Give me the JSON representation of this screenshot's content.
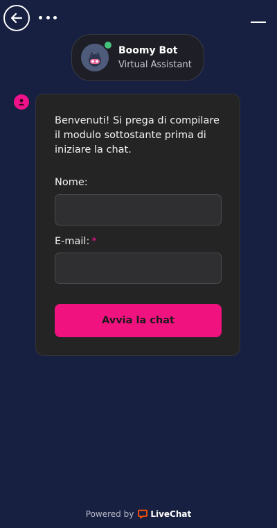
{
  "bot": {
    "name": "Boomy Bot",
    "role": "Virtual Assistant"
  },
  "form": {
    "intro": "Benvenuti! Si prega di compilare il modulo sottostante prima di iniziare la chat.",
    "name_label": "Nome:",
    "email_label": "E-mail:",
    "required_mark": "*",
    "submit_label": "Avvia la chat"
  },
  "footer": {
    "powered_by": "Powered by",
    "brand": "LiveChat"
  },
  "colors": {
    "background": "#172041",
    "accent": "#f0127f",
    "online": "#46c17e",
    "card": "#242424"
  },
  "icons": [
    "back-arrow-icon",
    "more-dots-icon",
    "minimize-icon",
    "bot-avatar-icon",
    "user-icon",
    "livechat-logo-icon"
  ]
}
